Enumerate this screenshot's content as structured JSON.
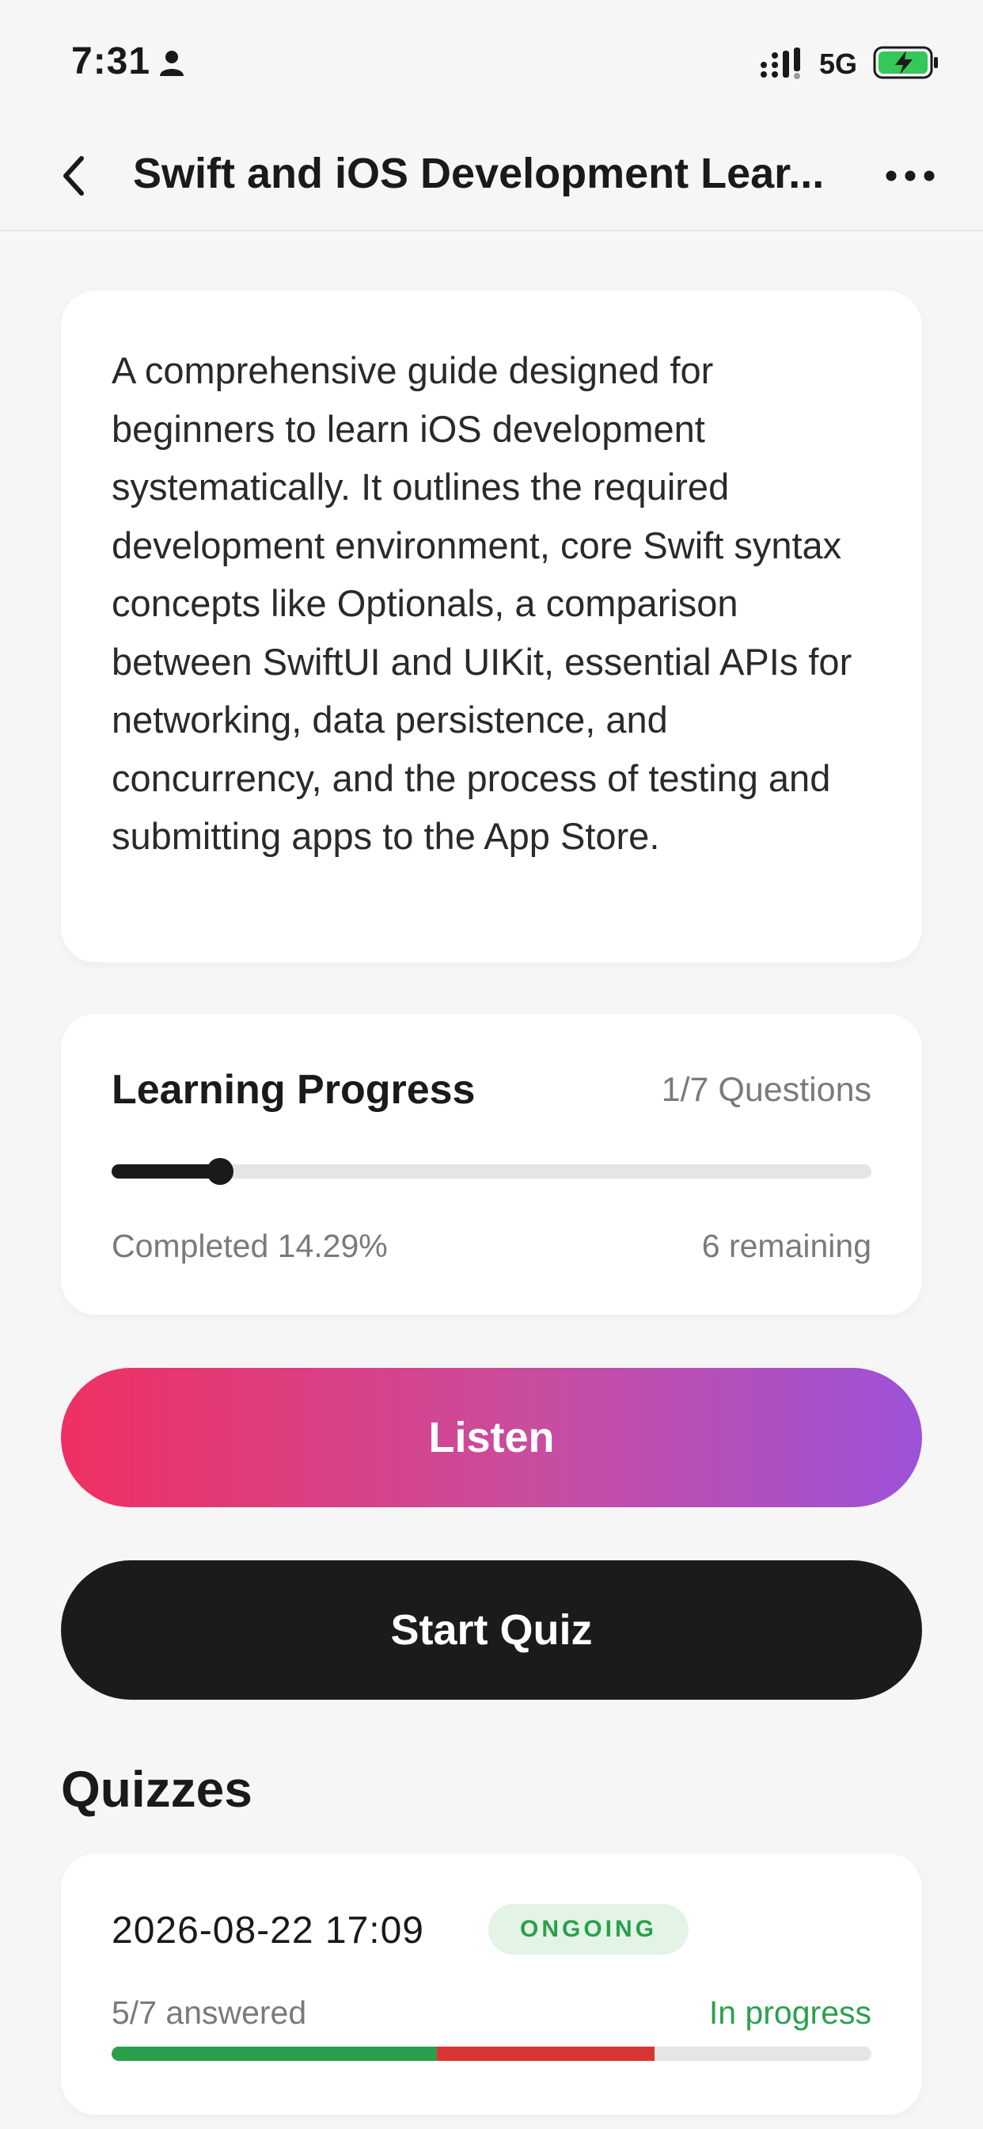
{
  "status_bar": {
    "time": "7:31",
    "network": "5G"
  },
  "nav": {
    "title": "Swift and iOS Development Lear..."
  },
  "description": "A comprehensive guide designed for beginners to learn iOS development systematically. It outlines the required development environment, core Swift syntax concepts like Optionals, a comparison between SwiftUI and UIKit, essential APIs for networking, data persistence, and concurrency, and the process of testing and submitting apps to the App Store.",
  "progress": {
    "title": "Learning Progress",
    "count": "1/7 Questions",
    "completed": "Completed 14.29%",
    "remaining": "6 remaining",
    "fraction": 0.1429
  },
  "buttons": {
    "listen": "Listen",
    "start_quiz": "Start Quiz"
  },
  "quizzes": {
    "title": "Quizzes",
    "items": [
      {
        "date": "2026-08-22 17:09",
        "badge": "ONGOING",
        "answered": "5/7 answered",
        "status": "In progress",
        "correct_fraction": 0.4286,
        "wrong_fraction": 0.2857
      }
    ]
  },
  "colors": {
    "correct": "#2aa04d",
    "wrong": "#d93535",
    "gradient_start": "#ef3062",
    "gradient_end": "#9d52d8"
  }
}
